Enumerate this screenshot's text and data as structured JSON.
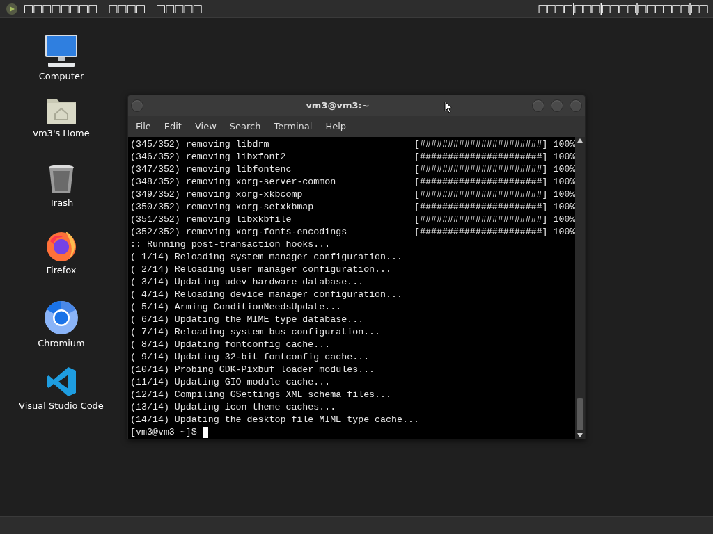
{
  "top_bar": {
    "left_items": [
      "□□□□□□□□",
      "□□□□",
      "□□□□□"
    ],
    "right_text": "□□□□|□□□|□□□□|□□□□□□|□□"
  },
  "desktop_icons": [
    {
      "kind": "computer",
      "label": "Computer"
    },
    {
      "kind": "home",
      "label": "vm3's Home"
    },
    {
      "kind": "trash",
      "label": "Trash"
    },
    {
      "kind": "firefox",
      "label": "Firefox"
    },
    {
      "kind": "chromium",
      "label": "Chromium"
    },
    {
      "kind": "vscode",
      "label": "Visual Studio Code"
    }
  ],
  "terminal": {
    "title": "vm3@vm3:~",
    "menu": [
      "File",
      "Edit",
      "View",
      "Search",
      "Terminal",
      "Help"
    ],
    "lines": [
      {
        "kind": "progress",
        "text": "(345/352) removing libdrm",
        "bar": "[######################]",
        "percent": "100%"
      },
      {
        "kind": "progress",
        "text": "(346/352) removing libxfont2",
        "bar": "[######################]",
        "percent": "100%"
      },
      {
        "kind": "progress",
        "text": "(347/352) removing libfontenc",
        "bar": "[######################]",
        "percent": "100%"
      },
      {
        "kind": "progress",
        "text": "(348/352) removing xorg-server-common",
        "bar": "[######################]",
        "percent": "100%"
      },
      {
        "kind": "progress",
        "text": "(349/352) removing xorg-xkbcomp",
        "bar": "[######################]",
        "percent": "100%"
      },
      {
        "kind": "progress",
        "text": "(350/352) removing xorg-setxkbmap",
        "bar": "[######################]",
        "percent": "100%"
      },
      {
        "kind": "progress",
        "text": "(351/352) removing libxkbfile",
        "bar": "[######################]",
        "percent": "100%"
      },
      {
        "kind": "progress",
        "text": "(352/352) removing xorg-fonts-encodings",
        "bar": "[######################]",
        "percent": "100%"
      },
      {
        "kind": "text",
        "text": ":: Running post-transaction hooks..."
      },
      {
        "kind": "text",
        "text": "( 1/14) Reloading system manager configuration..."
      },
      {
        "kind": "text",
        "text": "( 2/14) Reloading user manager configuration..."
      },
      {
        "kind": "text",
        "text": "( 3/14) Updating udev hardware database..."
      },
      {
        "kind": "text",
        "text": "( 4/14) Reloading device manager configuration..."
      },
      {
        "kind": "text",
        "text": "( 5/14) Arming ConditionNeedsUpdate..."
      },
      {
        "kind": "text",
        "text": "( 6/14) Updating the MIME type database..."
      },
      {
        "kind": "text",
        "text": "( 7/14) Reloading system bus configuration..."
      },
      {
        "kind": "text",
        "text": "( 8/14) Updating fontconfig cache..."
      },
      {
        "kind": "text",
        "text": "( 9/14) Updating 32-bit fontconfig cache..."
      },
      {
        "kind": "text",
        "text": "(10/14) Probing GDK-Pixbuf loader modules..."
      },
      {
        "kind": "text",
        "text": "(11/14) Updating GIO module cache..."
      },
      {
        "kind": "text",
        "text": "(12/14) Compiling GSettings XML schema files..."
      },
      {
        "kind": "text",
        "text": "(13/14) Updating icon theme caches..."
      },
      {
        "kind": "text",
        "text": "(14/14) Updating the desktop file MIME type cache..."
      }
    ],
    "prompt": "[vm3@vm3 ~]$"
  }
}
